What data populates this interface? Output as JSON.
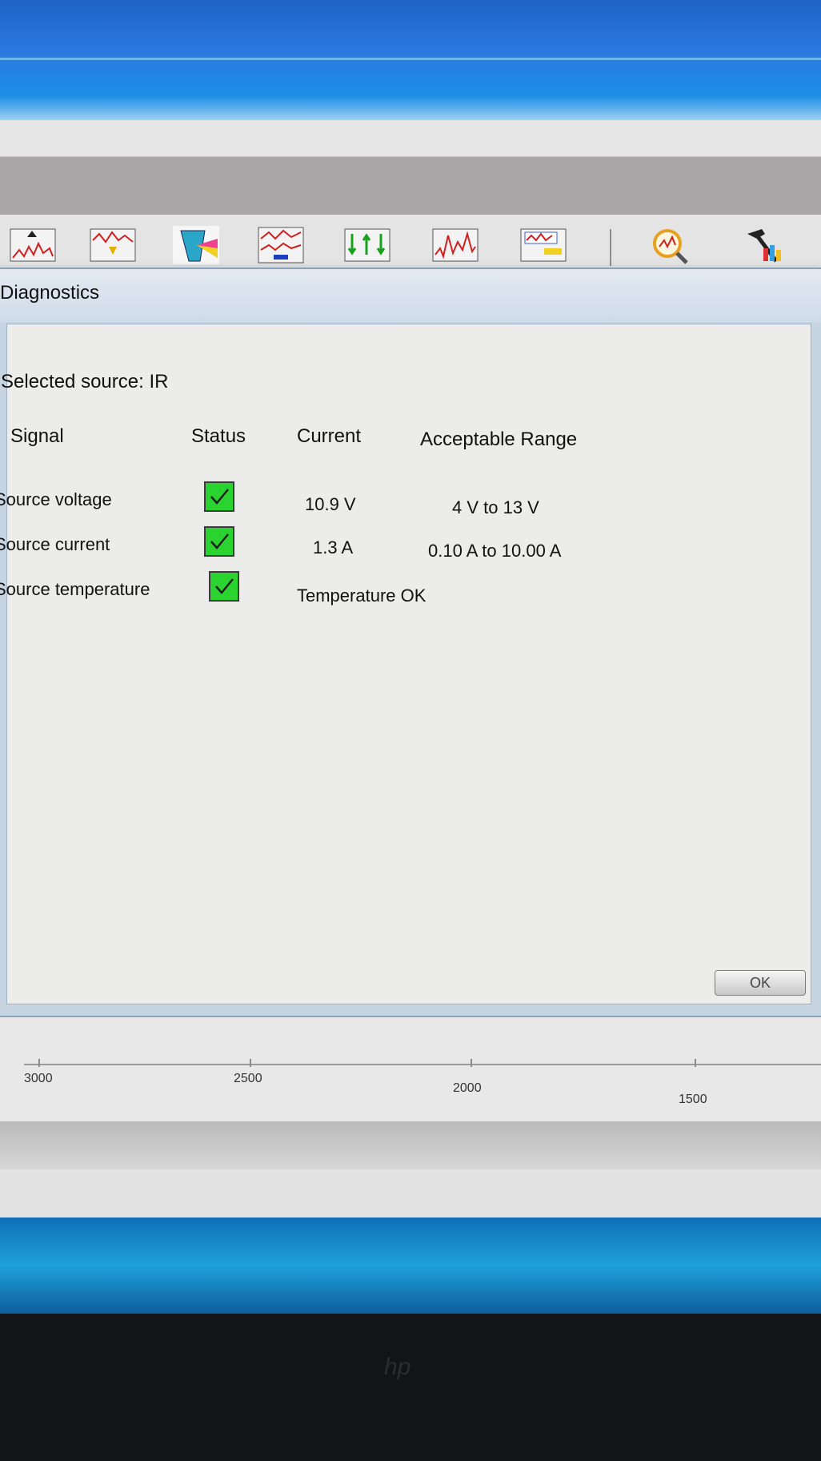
{
  "dialog": {
    "title": "Diagnostics",
    "selected_source": "Selected source:  IR",
    "headers": {
      "signal": "Signal",
      "status": "Status",
      "current": "Current",
      "range": "Acceptable Range"
    },
    "rows": [
      {
        "signal": "Source voltage",
        "status": "ok",
        "current": "10.9 V",
        "range": "4 V to 13 V"
      },
      {
        "signal": "Source current",
        "status": "ok",
        "current": "1.3 A",
        "range": "0.10 A to 10.00 A"
      },
      {
        "signal": "Source temperature",
        "status": "ok",
        "current": "Temperature OK",
        "range": ""
      }
    ],
    "ok_label": "OK"
  },
  "toolbar": {
    "icons": [
      "spectrum-up-icon",
      "spectrum-down-icon",
      "prism-icon",
      "overlay-icon",
      "arrows-icon",
      "peaks-icon",
      "display-icon",
      "magnifier-icon",
      "tools-icon"
    ]
  },
  "axis": {
    "ticks": [
      "3000",
      "2500",
      "2000",
      "1500"
    ]
  },
  "monitor": {
    "brand": "hp"
  },
  "colors": {
    "status_ok": "#2bd330"
  }
}
